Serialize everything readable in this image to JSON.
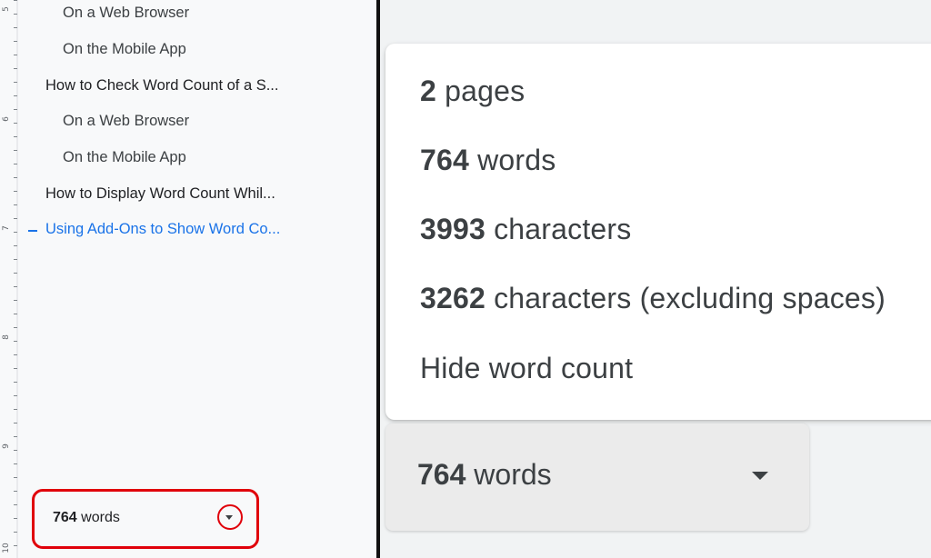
{
  "ruler": {
    "labels": [
      "5",
      "6",
      "7",
      "8",
      "9",
      "10"
    ]
  },
  "outline": {
    "items": [
      {
        "label": "On a Web Browser",
        "level": 2
      },
      {
        "label": "On the Mobile App",
        "level": 2
      },
      {
        "label": "How to Check Word Count of a S...",
        "level": 1
      },
      {
        "label": "On a Web Browser",
        "level": 2
      },
      {
        "label": "On the Mobile App",
        "level": 2
      },
      {
        "label": "How to Display Word Count Whil...",
        "level": 1
      },
      {
        "label": "Using Add-Ons to Show Word Co...",
        "level": 1,
        "active": true
      }
    ]
  },
  "word_count_chip": {
    "count": "764",
    "unit": "words",
    "dropdown_icon": "caret-down-icon"
  },
  "word_count_menu": {
    "stats": [
      {
        "value": "2",
        "label": "pages"
      },
      {
        "value": "764",
        "label": "words"
      },
      {
        "value": "3993",
        "label": "characters"
      },
      {
        "value": "3262",
        "label": "characters (excluding spaces)"
      }
    ],
    "hide_label": "Hide word count"
  },
  "word_count_chip_zoomed": {
    "count": "764",
    "unit": "words"
  },
  "colors": {
    "highlight": "#e0000a",
    "active_link": "#1a73e8",
    "text": "#3c4043"
  }
}
